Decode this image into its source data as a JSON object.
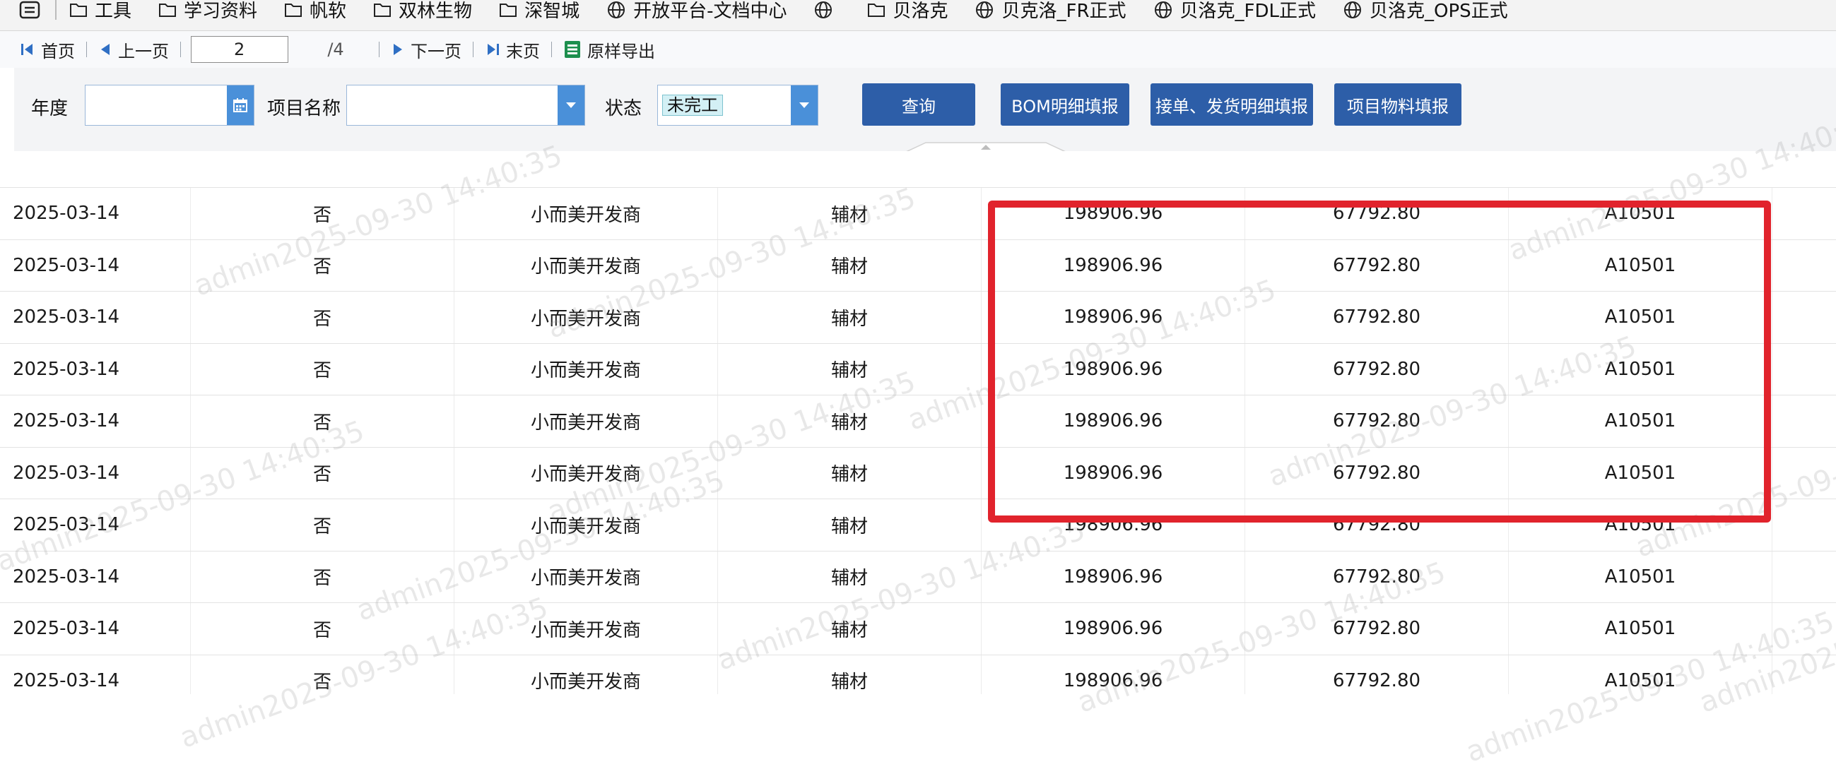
{
  "bookmarks": [
    {
      "label": "工具",
      "icon": "folder-icon"
    },
    {
      "label": "学习资料",
      "icon": "folder-icon"
    },
    {
      "label": "帆软",
      "icon": "folder-icon"
    },
    {
      "label": "双林生物",
      "icon": "folder-icon"
    },
    {
      "label": "深智城",
      "icon": "folder-icon"
    },
    {
      "label": "开放平台-文档中心",
      "icon": "globe-icon"
    },
    {
      "label": "",
      "icon": "globe-icon"
    },
    {
      "label": "贝洛克",
      "icon": "folder-icon"
    },
    {
      "label": "贝克洛_FR正式",
      "icon": "globe-icon"
    },
    {
      "label": "贝洛克_FDL正式",
      "icon": "globe-icon"
    },
    {
      "label": "贝洛克_OPS正式",
      "icon": "globe-icon"
    }
  ],
  "pager": {
    "first": "首页",
    "prev": "上一页",
    "current_page": "2",
    "total": "/4",
    "next": "下一页",
    "last": "末页",
    "export": "原样导出"
  },
  "filters": {
    "year_label": "年度",
    "year_value": "",
    "project_label": "项目名称",
    "project_value": "",
    "status_label": "状态",
    "status_value": "未完工",
    "query_button": "查询",
    "bom_button": "BOM明细填报",
    "order_button": "接单、发货明细填报",
    "material_button": "项目物料填报"
  },
  "table": {
    "rows": [
      [
        "2025-03-14",
        "否",
        "小而美开发商",
        "辅材",
        "198906.96",
        "67792.80",
        "A10501"
      ],
      [
        "2025-03-14",
        "否",
        "小而美开发商",
        "辅材",
        "198906.96",
        "67792.80",
        "A10501"
      ],
      [
        "2025-03-14",
        "否",
        "小而美开发商",
        "辅材",
        "198906.96",
        "67792.80",
        "A10501"
      ],
      [
        "2025-03-14",
        "否",
        "小而美开发商",
        "辅材",
        "198906.96",
        "67792.80",
        "A10501"
      ],
      [
        "2025-03-14",
        "否",
        "小而美开发商",
        "辅材",
        "198906.96",
        "67792.80",
        "A10501"
      ],
      [
        "2025-03-14",
        "否",
        "小而美开发商",
        "辅材",
        "198906.96",
        "67792.80",
        "A10501"
      ],
      [
        "2025-03-14",
        "否",
        "小而美开发商",
        "辅材",
        "198906.96",
        "67792.80",
        "A10501"
      ],
      [
        "2025-03-14",
        "否",
        "小而美开发商",
        "辅材",
        "198906.96",
        "67792.80",
        "A10501"
      ],
      [
        "2025-03-14",
        "否",
        "小而美开发商",
        "辅材",
        "198906.96",
        "67792.80",
        "A10501"
      ],
      [
        "2025-03-14",
        "否",
        "小而美开发商",
        "辅材",
        "198906.96",
        "67792.80",
        "A10501"
      ]
    ]
  },
  "watermark": {
    "text": "admin2025-09-30 14:40:35"
  },
  "colors": {
    "primary_button": "#2d5ea8",
    "dropdown_button": "#4a90d9",
    "highlight_border": "#e1232c",
    "status_tag_bg": "#d3f0f5"
  }
}
